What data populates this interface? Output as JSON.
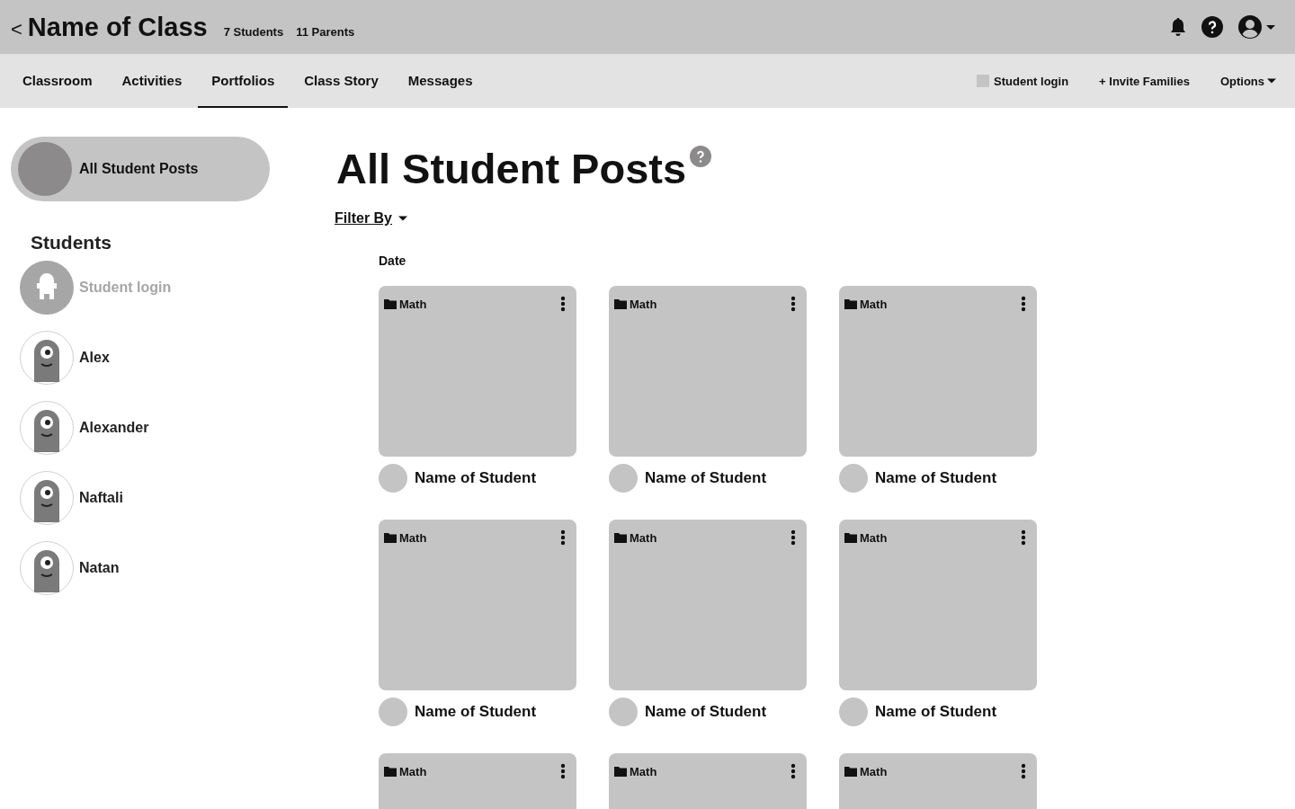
{
  "header": {
    "back": "<",
    "class_name": "Name of Class",
    "students_count": "7 Students",
    "parents_count": "11 Parents"
  },
  "tabs": [
    {
      "label": "Classroom",
      "selected": false
    },
    {
      "label": "Activities",
      "selected": false
    },
    {
      "label": "Portfolios",
      "selected": true
    },
    {
      "label": "Class Story",
      "selected": false
    },
    {
      "label": "Messages",
      "selected": false
    }
  ],
  "nav_actions": {
    "student_login": {
      "label": "Student login",
      "checked": false
    },
    "invite": "+ Invite Families",
    "options": "Options"
  },
  "sidebar": {
    "all_posts": {
      "label": "All Student Posts",
      "selected": true
    },
    "students_heading": "Students",
    "students": [
      {
        "name": "Student login",
        "kind": "login"
      },
      {
        "name": "Alex",
        "kind": "student"
      },
      {
        "name": "Alexander",
        "kind": "student"
      },
      {
        "name": "Naftali",
        "kind": "student"
      },
      {
        "name": "Natan",
        "kind": "student"
      }
    ]
  },
  "main": {
    "title": "All Student Posts",
    "filter": "Filter By",
    "group_label": "Date",
    "posts": [
      {
        "folder": "Math",
        "student": "Name of Student"
      },
      {
        "folder": "Math",
        "student": "Name of Student"
      },
      {
        "folder": "Math",
        "student": "Name of Student"
      },
      {
        "folder": "Math",
        "student": "Name of Student"
      },
      {
        "folder": "Math",
        "student": "Name of Student"
      },
      {
        "folder": "Math",
        "student": "Name of Student"
      },
      {
        "folder": "Math"
      },
      {
        "folder": "Math"
      },
      {
        "folder": "Math"
      }
    ]
  }
}
